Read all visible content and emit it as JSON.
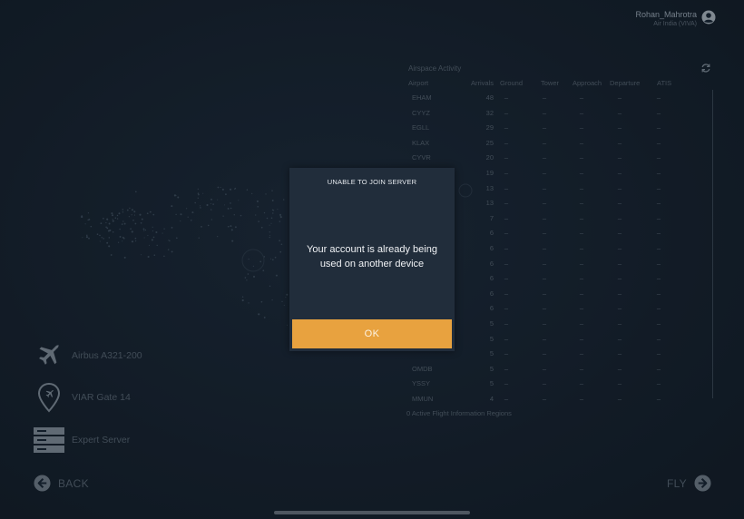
{
  "user": {
    "name": "Rohan_Mahrotra",
    "subtitle": "Air India (VIVA)",
    "avatar_icon": "user-circle-icon"
  },
  "activity": {
    "title": "Airspace Activity",
    "refresh_icon": "refresh-icon",
    "columns": [
      "Airport",
      "Arrivals",
      "Ground",
      "Tower",
      "Approach",
      "Departure",
      "ATIS"
    ],
    "rows": [
      {
        "icao": "EHAM",
        "arrivals": "48"
      },
      {
        "icao": "CYYZ",
        "arrivals": "32"
      },
      {
        "icao": "EGLL",
        "arrivals": "29"
      },
      {
        "icao": "KLAX",
        "arrivals": "25"
      },
      {
        "icao": "CYVR",
        "arrivals": "20"
      },
      {
        "icao": "",
        "arrivals": "19"
      },
      {
        "icao": "",
        "arrivals": "13"
      },
      {
        "icao": "",
        "arrivals": "13"
      },
      {
        "icao": "",
        "arrivals": "7"
      },
      {
        "icao": "",
        "arrivals": "6"
      },
      {
        "icao": "",
        "arrivals": "6"
      },
      {
        "icao": "",
        "arrivals": "6"
      },
      {
        "icao": "",
        "arrivals": "6"
      },
      {
        "icao": "",
        "arrivals": "6"
      },
      {
        "icao": "",
        "arrivals": "6"
      },
      {
        "icao": "",
        "arrivals": "5"
      },
      {
        "icao": "",
        "arrivals": "5"
      },
      {
        "icao": "",
        "arrivals": "5"
      },
      {
        "icao": "OMDB",
        "arrivals": "5"
      },
      {
        "icao": "YSSY",
        "arrivals": "5"
      },
      {
        "icao": "MMUN",
        "arrivals": "4"
      }
    ],
    "empty_cell": "–",
    "fir_text": "0 Active Flight Information Regions"
  },
  "info": {
    "aircraft": {
      "label": "Airbus A321-200",
      "icon": "airplane-icon"
    },
    "gate": {
      "label": "VIAR Gate 14",
      "icon": "airport-pin-icon"
    },
    "server": {
      "label": "Expert Server",
      "icon": "server-icon"
    }
  },
  "nav": {
    "back_label": "BACK",
    "fly_label": "FLY"
  },
  "modal": {
    "title": "UNABLE TO JOIN SERVER",
    "message": "Your account is already being used on another device",
    "ok_label": "OK"
  },
  "colors": {
    "background": "#182433",
    "modal_bg": "#212d3b",
    "accent": "#e8a23f",
    "muted_text": "#56626f"
  }
}
